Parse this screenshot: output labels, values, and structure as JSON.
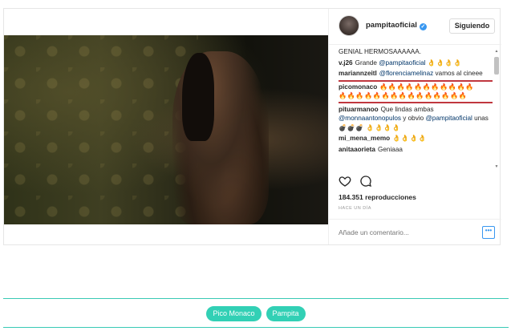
{
  "post": {
    "username": "pampitaoficial",
    "follow_label": "Siguiendo",
    "caption": "GENIAL HERMOSAAAAAA.",
    "comments": [
      {
        "user": "v.j26",
        "text_before": "Grande",
        "mention": "@pampitaoficial",
        "text_after": "",
        "emoji": "👌👌👌👌",
        "emoji2": ""
      },
      {
        "user": "mariannzeitl",
        "text_before": "",
        "mention": "@florenciamelinaz",
        "text_after": "vamos al cineee",
        "emoji": "",
        "emoji2": ""
      },
      {
        "user": "picomonaco",
        "text_before": "",
        "mention": "",
        "text_after": "",
        "emoji": "🔥🔥🔥🔥🔥🔥🔥🔥🔥🔥🔥",
        "emoji2": "🔥🔥🔥🔥🔥🔥🔥🔥🔥🔥🔥🔥🔥🔥🔥"
      },
      {
        "user": "pituarmanoo",
        "text_before": "Que lindas ambas",
        "mention": "@monnaantonopulos",
        "text_after": "y obvio",
        "mention2": "@pampitaoficial",
        "text_after2": "unas",
        "emoji": "💣💣💣",
        "emoji2": "👌👌👌👌"
      },
      {
        "user": "mi_mena_memo",
        "text_before": "",
        "mention": "",
        "text_after": "",
        "emoji": "👌👌👌👌",
        "emoji2": ""
      },
      {
        "user": "anitaaorieta",
        "text_before": "Geniaaa",
        "mention": "",
        "text_after": "",
        "emoji": "",
        "emoji2": ""
      }
    ],
    "views": "184.351 reproducciones",
    "time_ago": "HACE UN DÍA",
    "comment_placeholder": "Añade un comentario...",
    "more_label": "•••"
  },
  "tags": [
    "Pico Monaco",
    "Pampita"
  ],
  "icons": {
    "verified": "verified-badge-icon",
    "like": "heart-icon",
    "comment": "comment-bubble-icon"
  },
  "colors": {
    "highlight": "#c0373f",
    "tag_bg": "#32d0b5",
    "tag_border": "#39c9b5",
    "verified": "#3897f0"
  }
}
